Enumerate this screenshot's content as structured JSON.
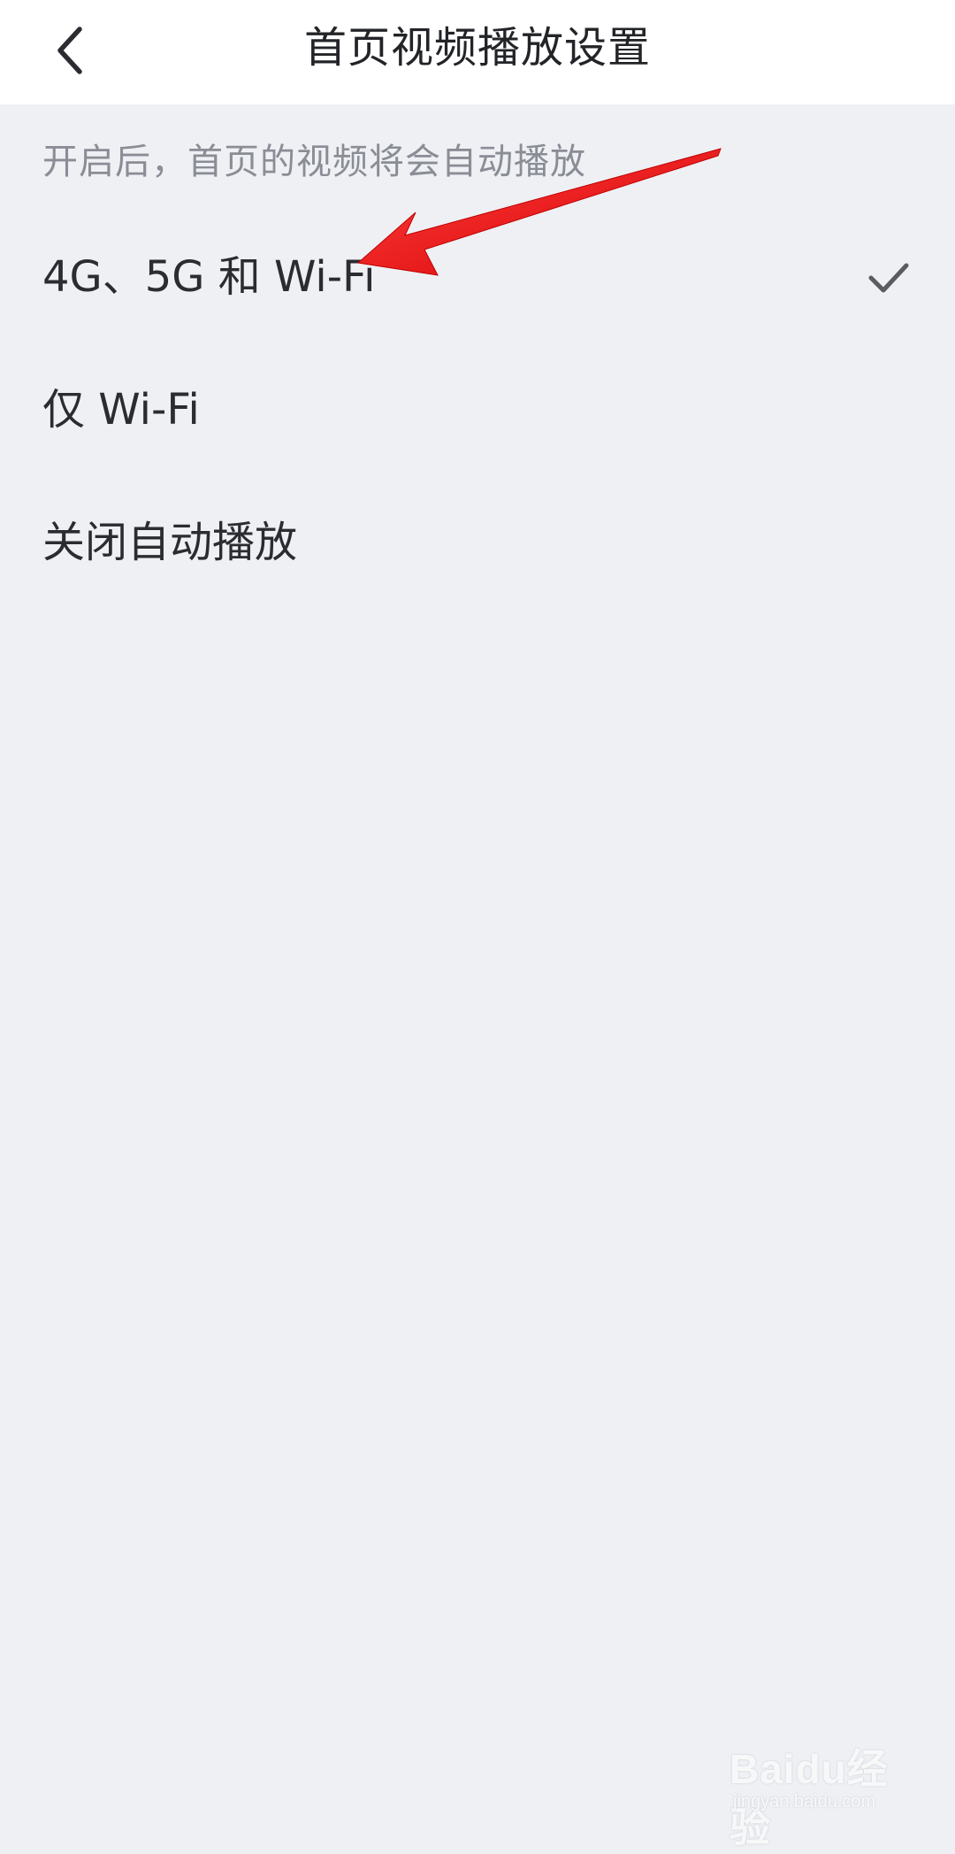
{
  "header": {
    "title": "首页视频播放设置",
    "back_icon": "chevron-left-icon"
  },
  "hint": "开启后，首页的视频将会自动播放",
  "options": [
    {
      "label": "4G、5G 和 Wi-Fi",
      "selected": true
    },
    {
      "label": "仅 Wi-Fi",
      "selected": false
    },
    {
      "label": "关闭自动播放",
      "selected": false
    }
  ],
  "check_icon": "checkmark-icon",
  "annotation": {
    "type": "arrow",
    "color": "#ff0000"
  },
  "watermark": {
    "main": "Baidu经验",
    "sub": "jingyan.baidu.com"
  },
  "colors": {
    "background": "#eef0f4",
    "header_bg": "#ffffff",
    "title_text": "#222428",
    "hint_text": "#8a8d95",
    "option_text": "#2a2c31",
    "check": "#5a5c62"
  }
}
